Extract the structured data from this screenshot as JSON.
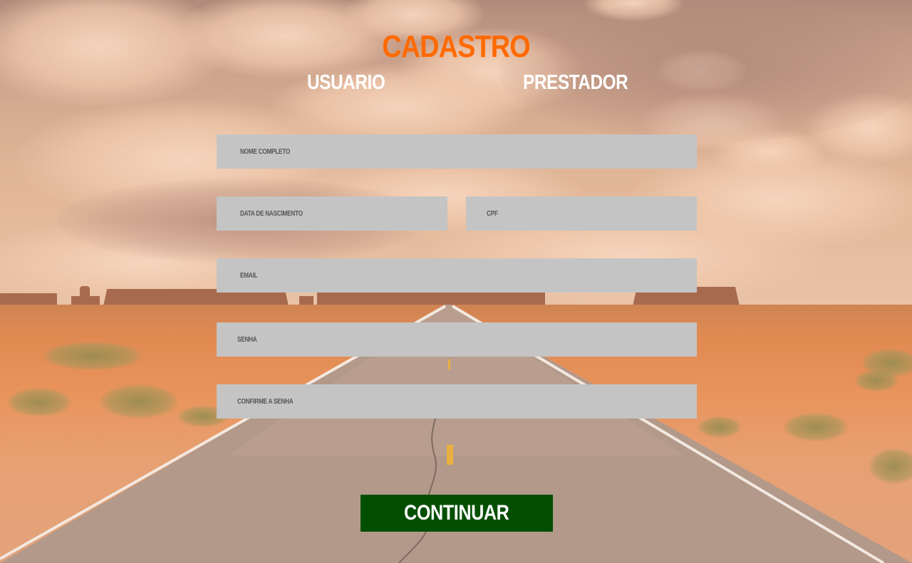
{
  "title": "CADASTRO",
  "tabs": {
    "usuario": "USUARIO",
    "prestador": "PRESTADOR"
  },
  "form": {
    "nome_completo": "NOME COMPLETO",
    "data_nascimento": "DATA DE NASCIMENTO",
    "cpf": "CPF",
    "email": "EMAIL",
    "senha": "SENHA",
    "confirme_senha": "CONFIRME A SENHA"
  },
  "continue_label": "CONTINUAR",
  "colors": {
    "title": "#ff6a00",
    "tab_text": "#ffffff",
    "field_bg": "#c4c4c4",
    "placeholder": "#555555",
    "button_bg": "#024f02",
    "button_text": "#ffffff"
  }
}
